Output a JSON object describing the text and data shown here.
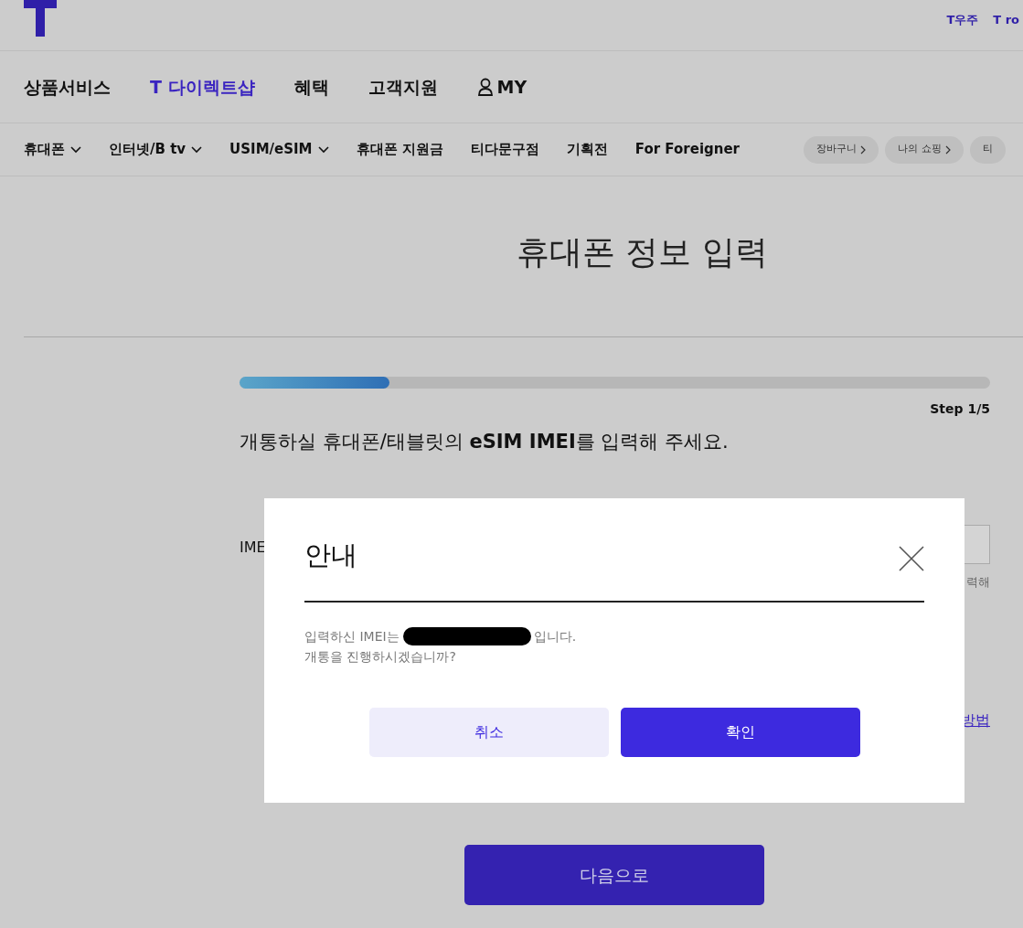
{
  "top_links": [
    "T우주",
    "T ro"
  ],
  "main_nav": [
    {
      "label": "상품서비스",
      "selected": false,
      "kind": "text"
    },
    {
      "label": "T 다이렉트샵",
      "selected": true,
      "kind": "text"
    },
    {
      "label": "혜택",
      "selected": false,
      "kind": "text"
    },
    {
      "label": "고객지원",
      "selected": false,
      "kind": "text"
    },
    {
      "label": "MY",
      "selected": false,
      "kind": "user"
    }
  ],
  "sub_nav": [
    {
      "label": "휴대폰",
      "dropdown": true
    },
    {
      "label": "인터넷/B tv",
      "dropdown": true
    },
    {
      "label": "USIM/eSIM",
      "dropdown": true
    },
    {
      "label": "휴대폰 지원금",
      "dropdown": false
    },
    {
      "label": "티다문구점",
      "dropdown": false
    },
    {
      "label": "기획전",
      "dropdown": false
    },
    {
      "label": "For Foreigner",
      "dropdown": false
    }
  ],
  "pills": [
    "장바구니",
    "나의 쇼핑",
    "티"
  ],
  "page_title": "휴대폰 정보 입력",
  "progress": {
    "level": 0.2,
    "label": "Step 1/5"
  },
  "instruction": "개통하실 휴대폰/태블릿의 **eSIM IMEI**를 입력해 주세요.",
  "field_label": "IME",
  "field_hint": "력해",
  "help_link": "방법",
  "dialog": {
    "title": "안내",
    "message_start": "입력하신 IMEI는",
    "message_end": "입니다.",
    "message_line2": "개통을 진행하시겠습니까?",
    "buttons": [
      {
        "label": "취소",
        "kind": "secondary"
      },
      {
        "label": "확인",
        "kind": "primary"
      }
    ]
  },
  "next_button": "다음으로"
}
